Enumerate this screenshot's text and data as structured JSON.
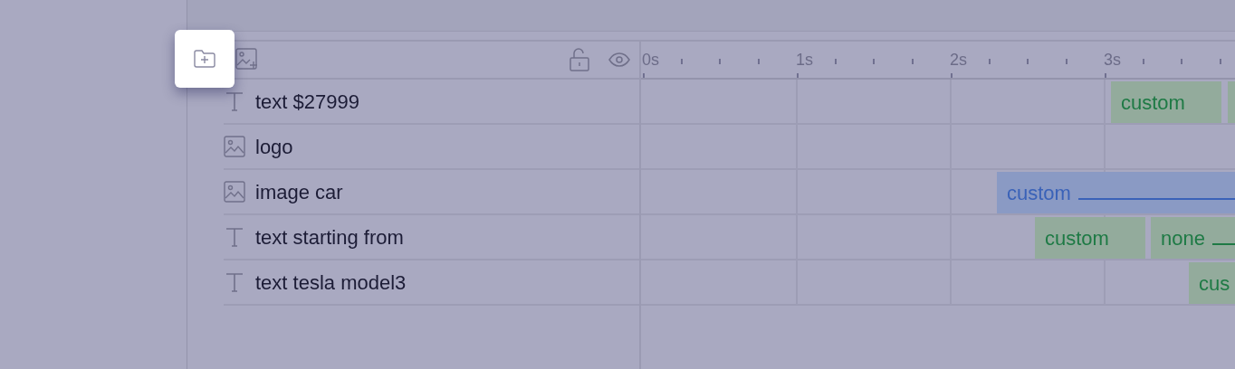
{
  "toolbar": {
    "buttons": [
      {
        "kind": "add-folder",
        "highlighted": true
      },
      {
        "kind": "add-image",
        "highlighted": false
      }
    ]
  },
  "timeline": {
    "ticks": [
      "0s",
      "1s",
      "2s",
      "3s"
    ]
  },
  "layers": [
    {
      "kind": "text",
      "name": "text $27999",
      "clips": [
        {
          "kind": "clip",
          "label": "custom",
          "line": false
        },
        {
          "kind": "clip"
        }
      ]
    },
    {
      "kind": "image",
      "name": "logo"
    },
    {
      "kind": "image",
      "name": "image car",
      "clips": [
        {
          "kind": "clip",
          "label": "custom",
          "line": true
        }
      ]
    },
    {
      "kind": "text",
      "name": "text starting from",
      "clips": [
        {
          "kind": "clip",
          "label": "custom",
          "line": false
        },
        {
          "kind": "clip",
          "label": "none",
          "line": true
        }
      ]
    },
    {
      "kind": "text",
      "name": "text tesla model3",
      "clips": [
        {
          "kind": "clip",
          "label": "cus"
        }
      ]
    }
  ]
}
